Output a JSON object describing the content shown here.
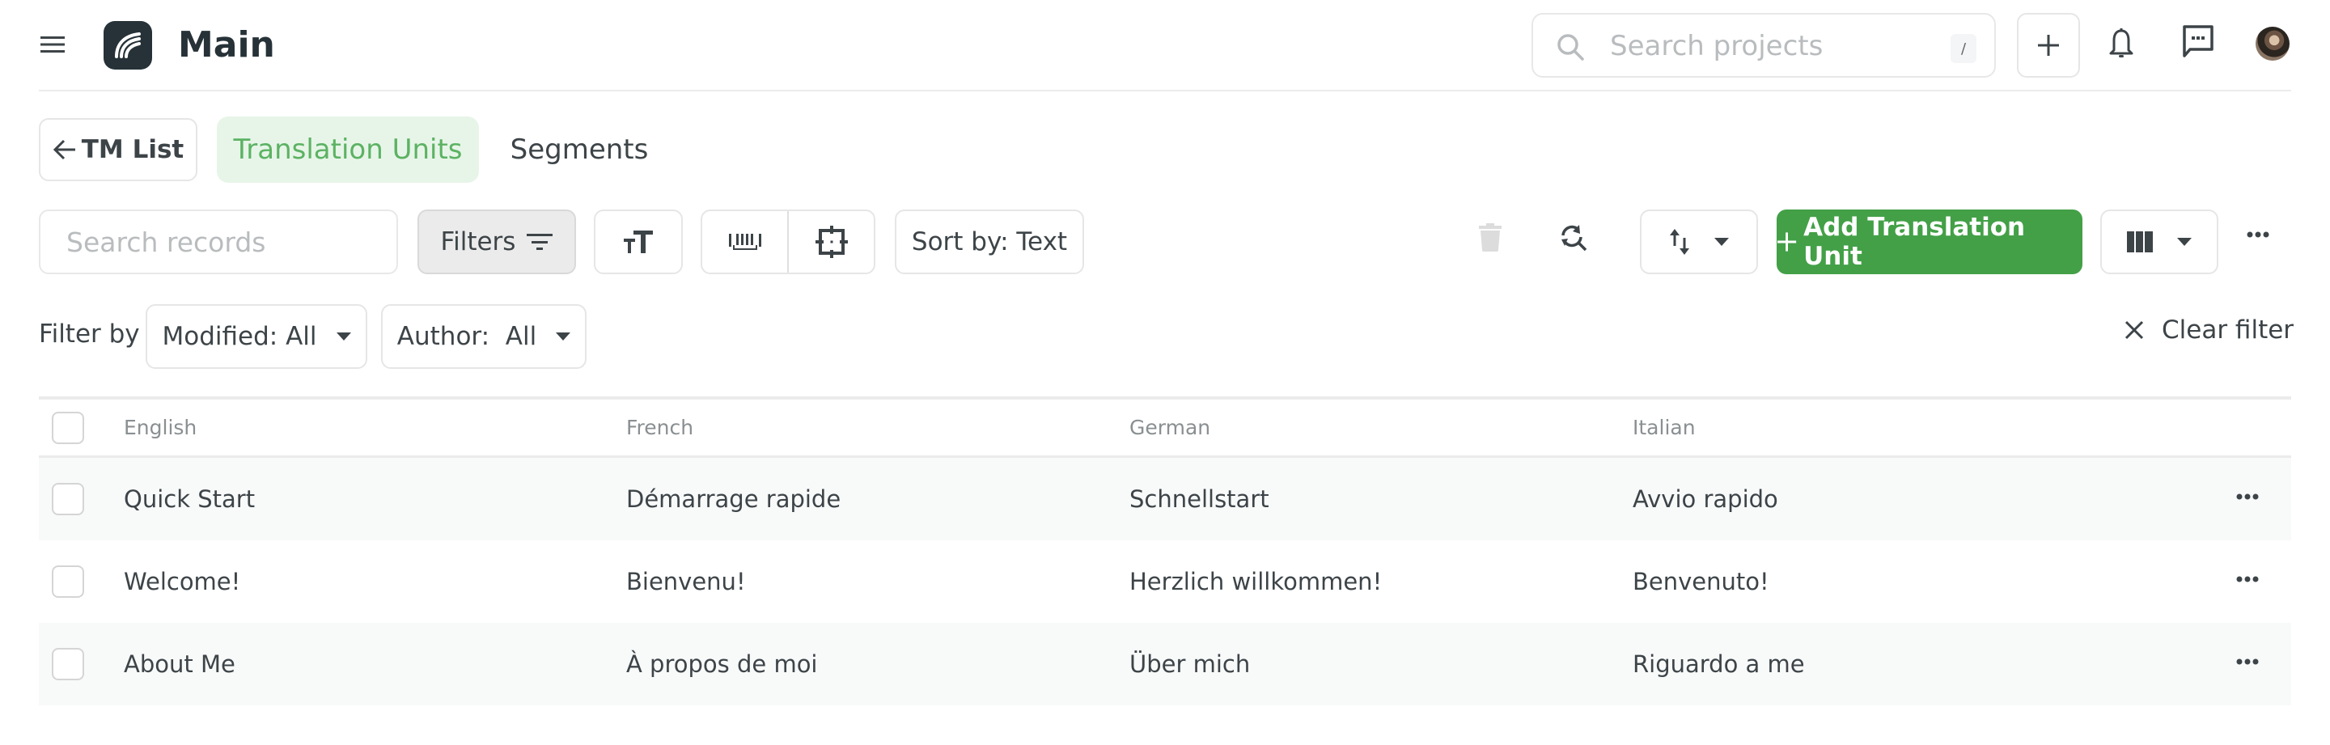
{
  "header": {
    "app_title": "Main",
    "search_placeholder": "Search projects",
    "search_shortcut": "/",
    "icons": {
      "menu": "hamburger-menu-icon",
      "logo": "app-logo-icon",
      "search": "search-icon",
      "add": "plus-icon",
      "notifications": "bell-icon",
      "messages": "chat-icon",
      "avatar": "user-avatar"
    }
  },
  "tabs": {
    "back_label": "TM List",
    "items": [
      {
        "label": "Translation Units",
        "active": true
      },
      {
        "label": "Segments",
        "active": false
      }
    ]
  },
  "toolbar": {
    "search_placeholder": "Search records",
    "filters_label": "Filters",
    "sort_label": "Sort by: Text",
    "add_label": "Add Translation Unit",
    "icons": [
      "font-size-icon",
      "space-bar-icon",
      "focus-center-icon",
      "trash-icon",
      "find-replace-icon",
      "sort-order-icon",
      "columns-icon",
      "more-horizontal-icon"
    ]
  },
  "filters": {
    "label": "Filter by",
    "modified_label": "Modified: All",
    "author_label": "Author:  All",
    "clear_label": "Clear filter"
  },
  "table": {
    "columns": [
      "English",
      "French",
      "German",
      "Italian"
    ],
    "rows": [
      [
        "Quick Start",
        "Démarrage rapide",
        "Schnellstart",
        "Avvio rapido"
      ],
      [
        "Welcome!",
        "Bienvenu!",
        "Herzlich willkommen!",
        "Benvenuto!"
      ],
      [
        "About Me",
        "À propos de moi",
        "Über mich",
        "Riguardo a me"
      ]
    ]
  },
  "colors": {
    "accent_green": "#43a047",
    "active_tab_bg": "#e7f5e8",
    "active_tab_text": "#5cb263",
    "text_primary": "#3d4448",
    "logo_bg": "#263238"
  }
}
